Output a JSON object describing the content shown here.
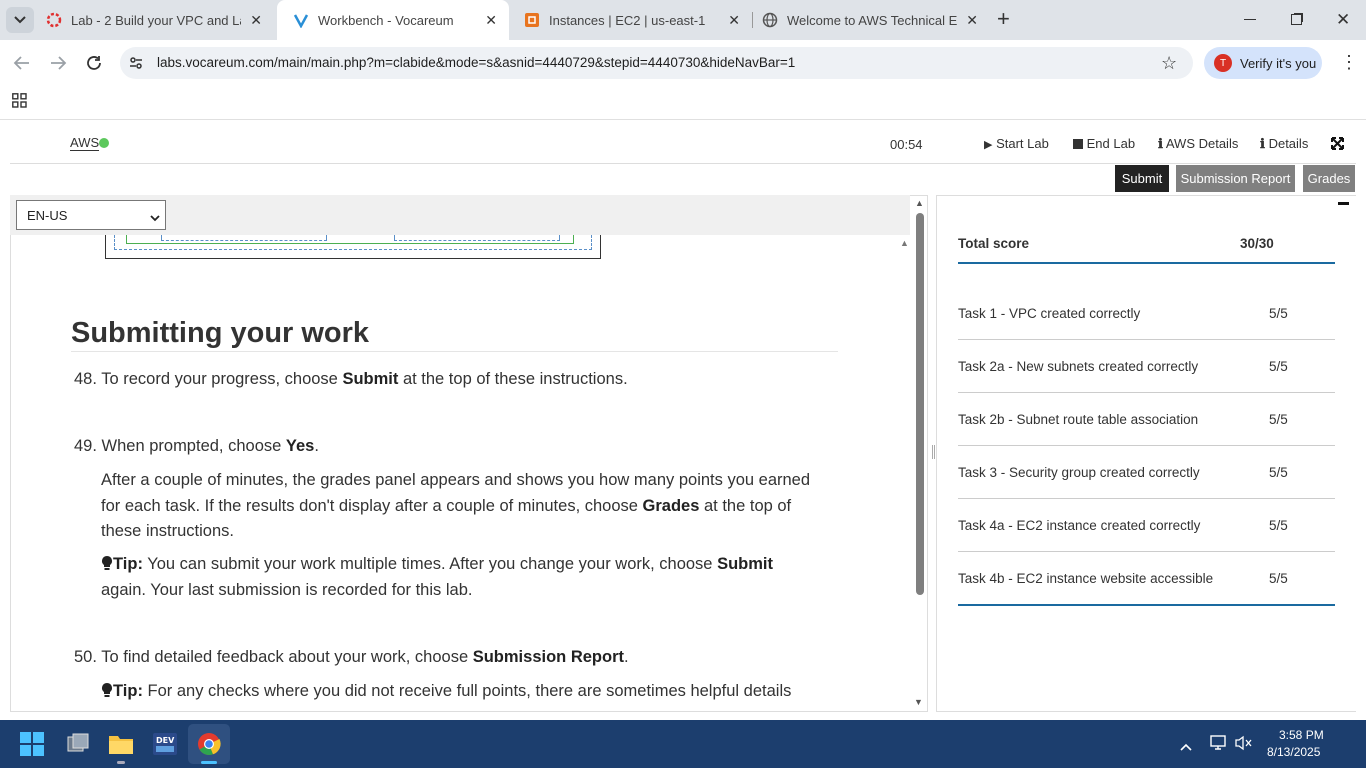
{
  "browser": {
    "tabs": [
      {
        "title": "Lab - 2 Build your VPC and Lau"
      },
      {
        "title": "Workbench - Vocareum"
      },
      {
        "title": "Instances | EC2 | us-east-1"
      },
      {
        "title": "Welcome to AWS Technical Esse"
      }
    ],
    "url": "labs.vocareum.com/main/main.php?m=clabide&mode=s&asnid=4440729&stepid=4440730&hideNavBar=1",
    "verify_label": "Verify it's you",
    "profile_initial": "T"
  },
  "vocareum": {
    "aws_label": "AWS",
    "timer": "00:54",
    "start_lab": "Start Lab",
    "end_lab": "End Lab",
    "aws_details": "AWS Details",
    "details": "Details",
    "submit": "Submit",
    "submission_report": "Submission Report",
    "grades": "Grades",
    "language": "EN-US"
  },
  "instructions": {
    "heading": "Submitting your work",
    "step48_num": "48.",
    "step48_a": "To record your progress, choose ",
    "step48_b": "Submit",
    "step48_c": " at the top of these instructions.",
    "step49_num": "49.",
    "step49_a": "When prompted, choose ",
    "step49_b": "Yes",
    "step49_c": ".",
    "para1_l1": "After a couple of minutes, the grades panel appears and shows you how many points you earned",
    "para1_l2a": "for each task. If the results don't display after a couple of minutes, choose ",
    "para1_l2b": "Grades",
    "para1_l2c": " at the top of",
    "para1_l3": "these instructions.",
    "tip_label": "Tip:",
    "tip1_a": " You can submit your work multiple times. After you change your work, choose ",
    "tip1_b": "Submit",
    "tip1_l2": "again. Your last submission is recorded for this lab.",
    "step50_num": "50.",
    "step50_a": "To find detailed feedback about your work, choose ",
    "step50_b": "Submission Report",
    "step50_c": ".",
    "tip2_a": " For any checks where you did not receive full points, there are sometimes helpful details"
  },
  "grades": {
    "total_label": "Total score",
    "total_value": "30/30",
    "tasks": [
      {
        "name": "Task 1 - VPC created correctly",
        "score": "5/5"
      },
      {
        "name": "Task 2a - New subnets created correctly",
        "score": "5/5"
      },
      {
        "name": "Task 2b - Subnet route table association",
        "score": "5/5"
      },
      {
        "name": "Task 3 - Security group created correctly",
        "score": "5/5"
      },
      {
        "name": "Task 4a - EC2 instance created correctly",
        "score": "5/5"
      },
      {
        "name": "Task 4b - EC2 instance website accessible",
        "score": "5/5"
      }
    ]
  },
  "taskbar": {
    "time": "3:58 PM",
    "date": "8/13/2025"
  },
  "colors": {
    "tabstrip": "#dfe3e8",
    "taskbar": "#1c3e6e",
    "accent_line": "#1a6aa0",
    "submit_btn": "#222222",
    "grey_btn": "#808080"
  }
}
